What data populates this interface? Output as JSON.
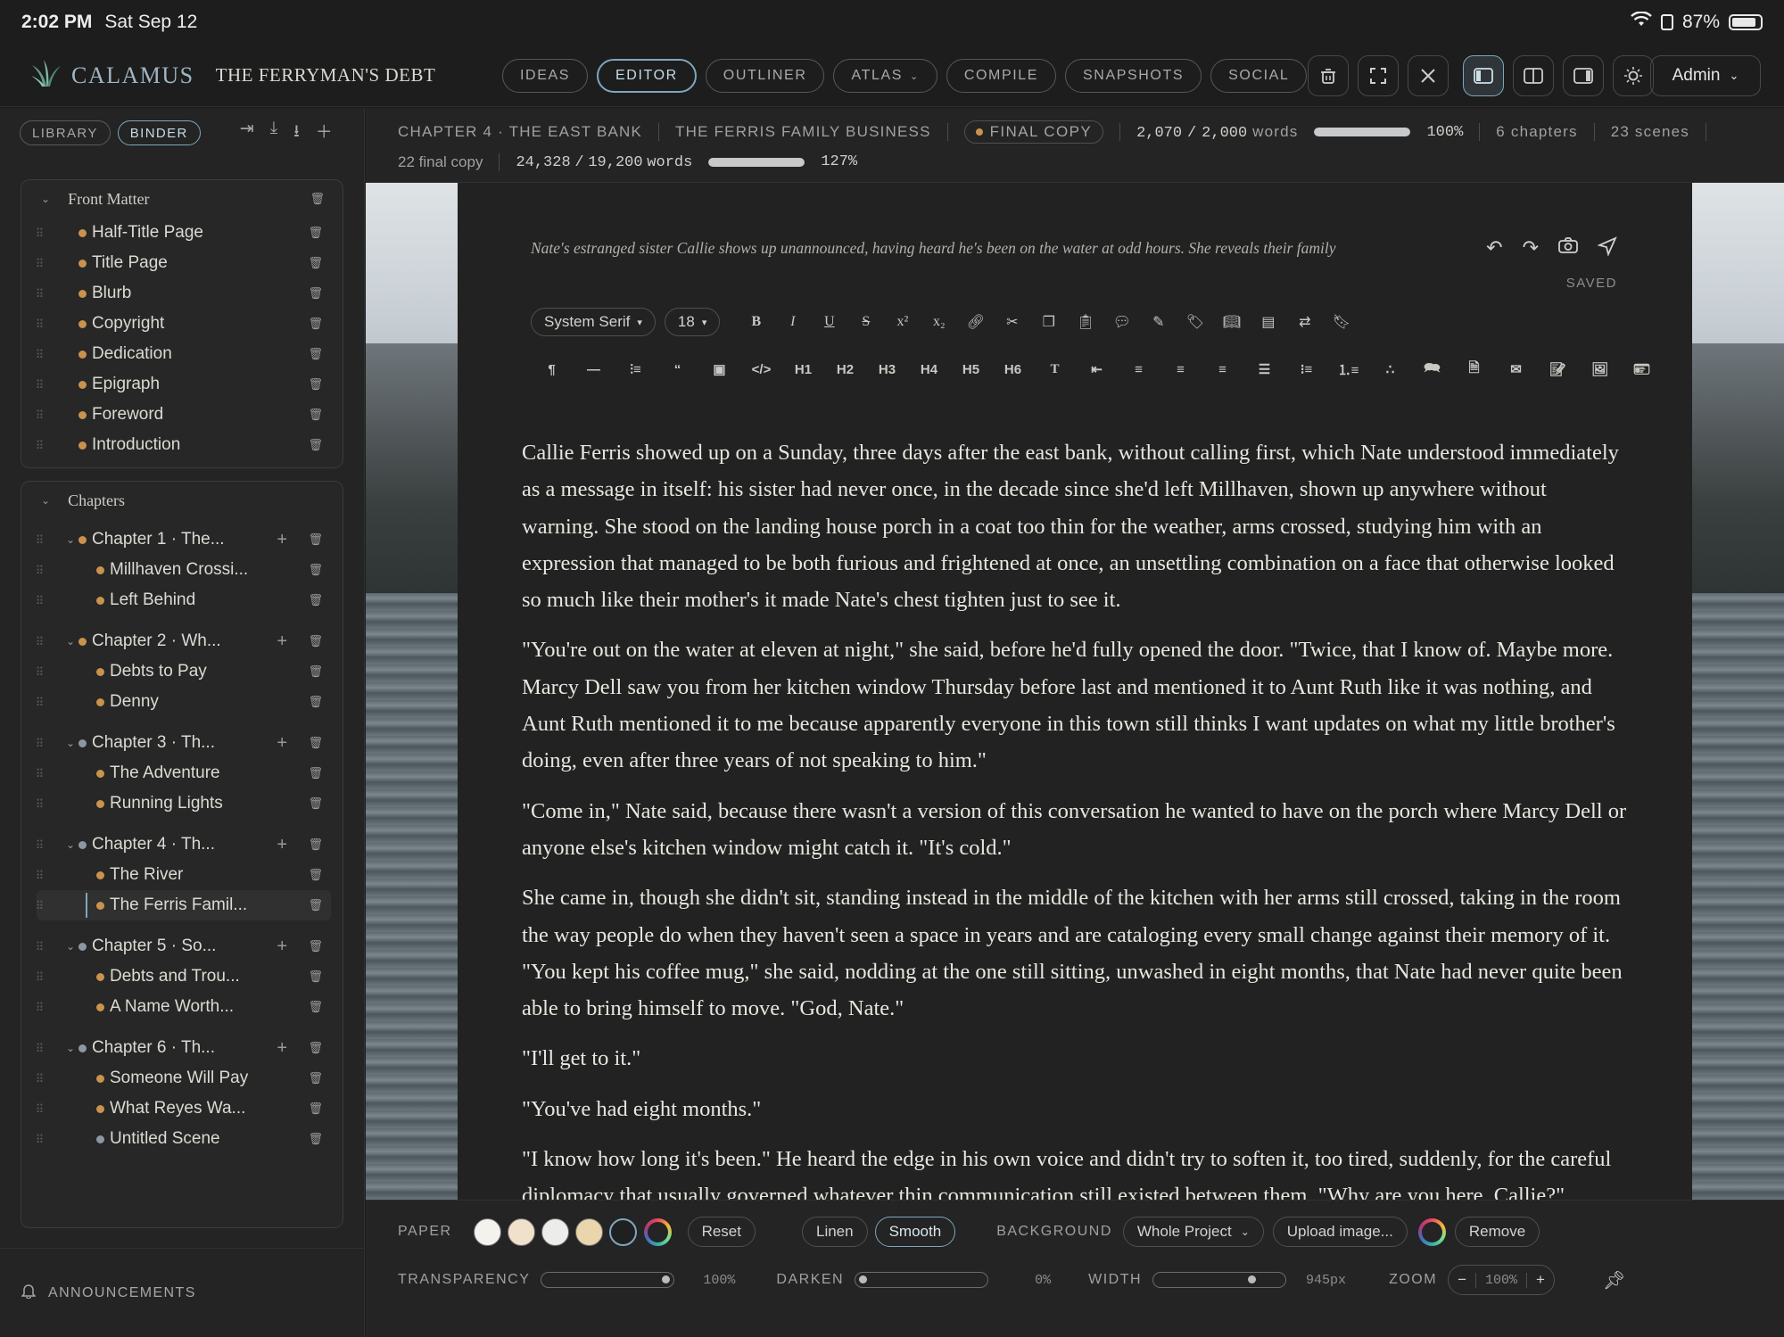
{
  "status_bar": {
    "time": "2:02 PM",
    "date": "Sat Sep 12",
    "battery": "87%",
    "battery_level": 0.87
  },
  "app": {
    "name": "CALAMUS",
    "project_title": "THE FERRYMAN'S DEBT"
  },
  "nav": {
    "tabs": [
      {
        "label": "IDEAS",
        "active": false
      },
      {
        "label": "EDITOR",
        "active": true
      },
      {
        "label": "OUTLINER",
        "active": false
      },
      {
        "label": "ATLAS",
        "active": false,
        "has_dropdown": true
      },
      {
        "label": "COMPILE",
        "active": false
      },
      {
        "label": "SNAPSHOTS",
        "active": false
      },
      {
        "label": "SOCIAL",
        "active": false
      }
    ],
    "tools": [
      "trash-bin-icon",
      "fullscreen-icon",
      "close-icon",
      "sidebar-left-icon",
      "split-view-icon",
      "sidebar-right-icon",
      "theme-sun-icon"
    ],
    "user_label": "Admin"
  },
  "sidebar": {
    "tabs": [
      {
        "label": "LIBRARY",
        "active": false
      },
      {
        "label": "BINDER",
        "active": true
      }
    ],
    "actions": [
      "import-icon",
      "download-icon",
      "export-icon",
      "add-icon"
    ],
    "front_matter": {
      "title": "Front Matter",
      "items": [
        "Half-Title Page",
        "Title Page",
        "Blurb",
        "Copyright",
        "Dedication",
        "Epigraph",
        "Foreword",
        "Introduction"
      ]
    },
    "chapters": {
      "title": "Chapters",
      "items": [
        {
          "title": "Chapter 1 · The...",
          "status": "final",
          "scenes": [
            {
              "title": "Millhaven Crossi...",
              "status": "final"
            },
            {
              "title": "Left Behind",
              "status": "final"
            }
          ]
        },
        {
          "title": "Chapter 2 · Wh...",
          "status": "final",
          "scenes": [
            {
              "title": "Debts to Pay",
              "status": "final"
            },
            {
              "title": "Denny",
              "status": "final"
            }
          ]
        },
        {
          "title": "Chapter 3 · Th...",
          "status": "draft",
          "scenes": [
            {
              "title": "The Adventure",
              "status": "final"
            },
            {
              "title": "Running Lights",
              "status": "final"
            }
          ]
        },
        {
          "title": "Chapter 4 · Th...",
          "status": "draft",
          "scenes": [
            {
              "title": "The River",
              "status": "final"
            },
            {
              "title": "The Ferris Famil...",
              "status": "final",
              "selected": true
            }
          ]
        },
        {
          "title": "Chapter 5 · So...",
          "status": "draft",
          "scenes": [
            {
              "title": "Debts and Trou...",
              "status": "final"
            },
            {
              "title": "A Name Worth...",
              "status": "final"
            }
          ]
        },
        {
          "title": "Chapter 6 · Th...",
          "status": "draft",
          "scenes": [
            {
              "title": "Someone Will Pay",
              "status": "final"
            },
            {
              "title": "What Reyes Wa...",
              "status": "final"
            },
            {
              "title": "Untitled Scene",
              "status": "draft"
            }
          ]
        }
      ]
    },
    "announcements_label": "ANNOUNCEMENTS"
  },
  "meta": {
    "chapter": "CHAPTER 4 · THE EAST BANK",
    "scene": "THE FERRIS FAMILY BUSINESS",
    "status_label": "FINAL COPY",
    "scene_words": "2,070",
    "scene_target": "2,000",
    "words_label": "words",
    "scene_progress_label": "100%",
    "scene_progress": 1.0,
    "chapters_count": "6 chapters",
    "scenes_count": "23 scenes",
    "final_copy_count": "22 final copy",
    "total_words": "24,328",
    "total_target": "19,200",
    "total_progress_label": "127%",
    "total_progress": 1.0
  },
  "editor": {
    "synopsis": "Nate's estranged sister Callie shows up unannounced, having heard he's been on the water at odd hours. She reveals their family has a deeper, older history with river smuggling than Nate knew, and warns him more directly than anyone has yet.",
    "saved_label": "SAVED",
    "font_family": "System Serif",
    "font_size": "18",
    "toolbar_row1": [
      "B",
      "I",
      "U",
      "S",
      "x²",
      "x₂"
    ],
    "toolbar_row2": [
      "¶",
      "—",
      "",
      "“",
      "",
      "</>",
      "H1",
      "H2",
      "H3",
      "H4",
      "H5",
      "H6",
      "T"
    ],
    "paragraphs": [
      "Callie Ferris showed up on a Sunday, three days after the east bank, without calling first, which Nate understood immediately as a message in itself: his sister had never once, in the decade since she'd left Millhaven, shown up anywhere without warning. She stood on the landing house porch in a coat too thin for the weather, arms crossed, studying him with an expression that managed to be both furious and frightened at once, an unsettling combination on a face that otherwise looked so much like their mother's it made Nate's chest tighten just to see it.",
      "\"You're out on the water at eleven at night,\" she said, before he'd fully opened the door. \"Twice, that I know of. Maybe more. Marcy Dell saw you from her kitchen window Thursday before last and mentioned it to Aunt Ruth like it was nothing, and Aunt Ruth mentioned it to me because apparently everyone in this town still thinks I want updates on what my little brother's doing, even after three years of not speaking to him.\"",
      "\"Come in,\" Nate said, because there wasn't a version of this conversation he wanted to have on the porch where Marcy Dell or anyone else's kitchen window might catch it. \"It's cold.\"",
      "She came in, though she didn't sit, standing instead in the middle of the kitchen with her arms still crossed, taking in the room the way people do when they haven't seen a space in years and are cataloging every small change against their memory of it. \"You kept his coffee mug,\" she said, nodding at the one still sitting, unwashed in eight months, that Nate had never quite been able to bring himself to move. \"God, Nate.\"",
      "\"I'll get to it.\"",
      "\"You've had eight months.\"",
      "\"I know how long it's been.\" He heard the edge in his own voice and didn't try to soften it, too tired, suddenly, for the careful diplomacy that usually governed whatever thin communication still existed between them. \"Why are you here, Callie?\""
    ]
  },
  "bottom": {
    "paper_label": "PAPER",
    "paper_swatches": [
      "#f4f2ee",
      "#efe1cc",
      "#ececea",
      "#ead6ad",
      "#1f2020"
    ],
    "reset_label": "Reset",
    "texture_options": [
      {
        "label": "Linen",
        "active": false
      },
      {
        "label": "Smooth",
        "active": true
      }
    ],
    "background_label": "BACKGROUND",
    "background_scope": "Whole Project",
    "upload_label": "Upload image...",
    "remove_label": "Remove",
    "transparency_label": "TRANSPARENCY",
    "transparency_value": "100%",
    "transparency": 1.0,
    "darken_label": "DARKEN",
    "darken_value": "0%",
    "darken": 0.0,
    "width_label": "WIDTH",
    "width_value": "945px",
    "width_fraction": 0.78,
    "zoom_label": "ZOOM",
    "zoom_value": "100%"
  },
  "colors": {
    "accent": "#7fa6be",
    "final_dot": "#c9924d",
    "draft_dot": "#8e96a6"
  }
}
